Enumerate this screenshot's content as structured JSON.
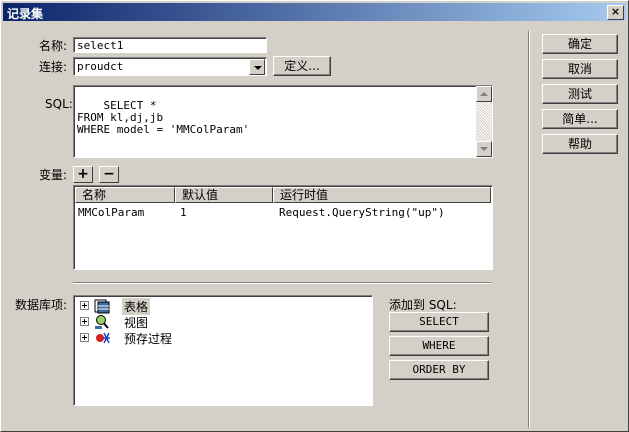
{
  "window": {
    "title": "记录集",
    "close_symbol": "×"
  },
  "form": {
    "name_label": "名称:",
    "name_value": "select1",
    "connection_label": "连接:",
    "connection_value": "proudct",
    "define_button": "定义...",
    "sql_label": "SQL:",
    "sql_text": "SELECT *\nFROM kl,dj,jb\nWHERE model = 'MMColParam'",
    "variables_label": "变量:",
    "add_symbol": "+",
    "remove_symbol": "−"
  },
  "variables_table": {
    "headers": [
      "名称",
      "默认值",
      "运行时值"
    ],
    "rows": [
      {
        "name": "MMColParam",
        "default": "1",
        "runtime": "Request.QueryString(\"up\")"
      }
    ]
  },
  "database": {
    "label": "数据库项:",
    "items": [
      {
        "label": "表格",
        "icon": "table-icon"
      },
      {
        "label": "视图",
        "icon": "view-icon"
      },
      {
        "label": "预存过程",
        "icon": "stored-procedure-icon"
      }
    ]
  },
  "add_to_sql": {
    "label": "添加到 SQL:",
    "buttons": [
      "SELECT",
      "WHERE",
      "ORDER BY"
    ]
  },
  "side_buttons": {
    "ok": "确定",
    "cancel": "取消",
    "test": "测试",
    "simple": "简单...",
    "help": "帮助"
  },
  "colors": {
    "titlebar_start": "#0a246a",
    "titlebar_end": "#a6caf0",
    "face": "#d4d0c8"
  }
}
